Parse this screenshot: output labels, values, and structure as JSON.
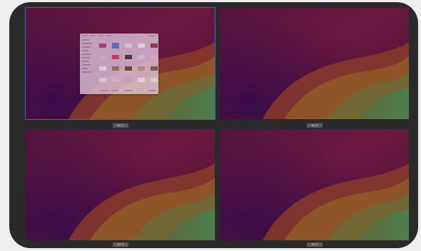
{
  "overview": {
    "workspaces": [
      {
        "label": "ws 1",
        "active": true
      },
      {
        "label": "ws 2",
        "active": false
      },
      {
        "label": "ws 3",
        "active": false
      },
      {
        "label": "ws 4",
        "active": false
      }
    ],
    "open_window": {
      "app": "file-manager",
      "workspace": "ws 1"
    }
  },
  "colors": {
    "frame": "#2a2a2a",
    "active_outline": "#3b67c8",
    "wallpaper_deep": "#3e0b3e",
    "wallpaper_magenta": "#7c1640",
    "wallpaper_orange": "#8a5a24",
    "wallpaper_green": "#4c7748",
    "label_bg": "#5a5a5a"
  }
}
